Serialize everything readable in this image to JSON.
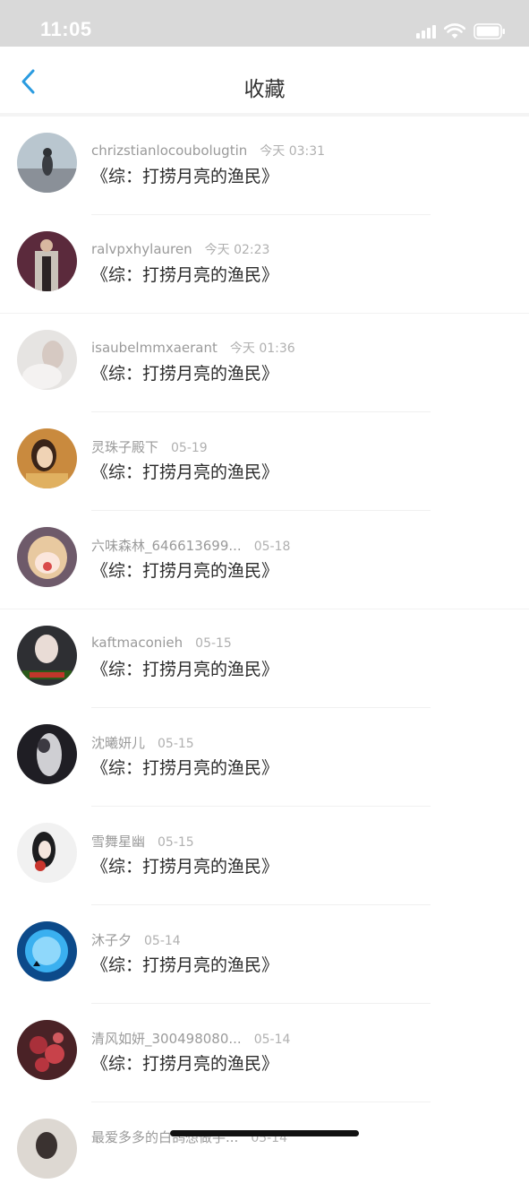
{
  "status_bar": {
    "time": "11:05"
  },
  "header": {
    "title": "收藏"
  },
  "items": [
    {
      "user": "chrizstianlocoubolugtin",
      "time": "今天 03:31",
      "title": "《综：打捞月亮的渔民》",
      "avatar_color": "#b9c6cf"
    },
    {
      "user": "ralvpxhylauren",
      "time": "今天 02:23",
      "title": "《综：打捞月亮的渔民》",
      "avatar_color": "#5b2a3c"
    },
    {
      "user": "isaubelmmxaerant",
      "time": "今天 01:36",
      "title": "《综：打捞月亮的渔民》",
      "avatar_color": "#e6e4e2"
    },
    {
      "user": "灵珠子殿下",
      "time": "05-19",
      "title": "《综：打捞月亮的渔民》",
      "avatar_color": "#c98a3e"
    },
    {
      "user": "六味森林_646613699...",
      "time": "05-18",
      "title": "《综：打捞月亮的渔民》",
      "avatar_color": "#e8c9a0"
    },
    {
      "user": "kaftmaconieh",
      "time": "05-15",
      "title": "《综：打捞月亮的渔民》",
      "avatar_color": "#2e2f33"
    },
    {
      "user": "沈曦妍儿",
      "time": "05-15",
      "title": "《综：打捞月亮的渔民》",
      "avatar_color": "#1f1e24"
    },
    {
      "user": "雪舞星幽",
      "time": "05-15",
      "title": "《综：打捞月亮的渔民》",
      "avatar_color": "#f1f1f1"
    },
    {
      "user": "沐子夕",
      "time": "05-14",
      "title": "《综：打捞月亮的渔民》",
      "avatar_color": "#0c4a8a"
    },
    {
      "user": "清风如妍_300498080...",
      "time": "05-14",
      "title": "《综：打捞月亮的渔民》",
      "avatar_color": "#a9303a"
    },
    {
      "user": "最爱多多的白鸽想做手...",
      "time": "05-14",
      "title": "",
      "avatar_color": "#ddd8d2"
    }
  ]
}
